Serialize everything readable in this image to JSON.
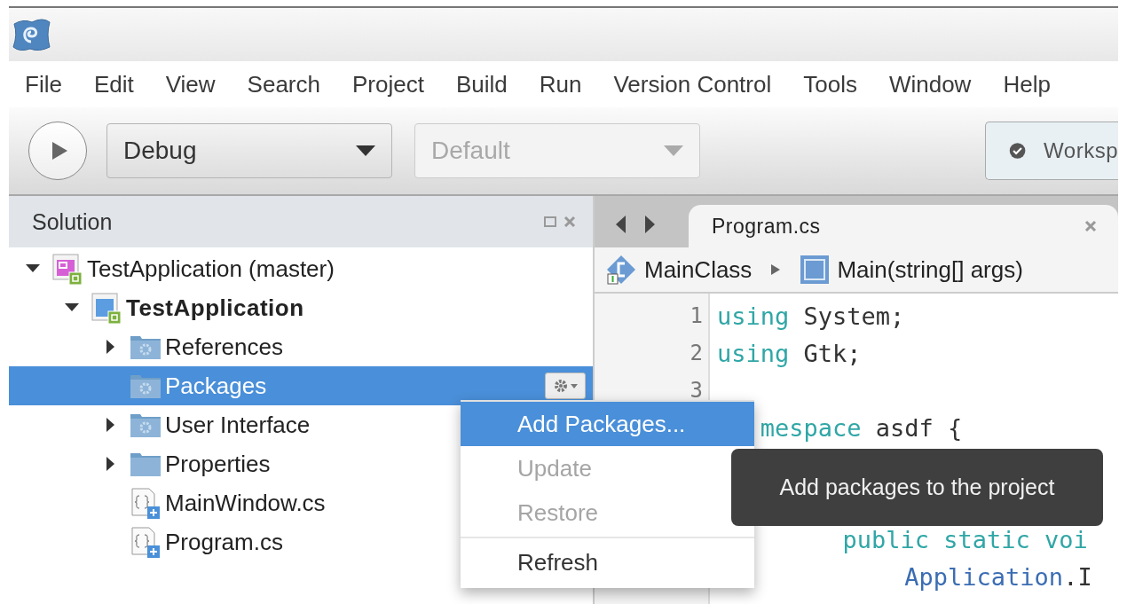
{
  "menu": [
    {
      "label": "File"
    },
    {
      "label": "Edit"
    },
    {
      "label": "View"
    },
    {
      "label": "Search"
    },
    {
      "label": "Project"
    },
    {
      "label": "Build"
    },
    {
      "label": "Run"
    },
    {
      "label": "Version Control"
    },
    {
      "label": "Tools"
    },
    {
      "label": "Window"
    },
    {
      "label": "Help"
    }
  ],
  "toolbar": {
    "configuration": {
      "value": "Debug",
      "disabled": false
    },
    "platform": {
      "value": "Default",
      "disabled": true
    },
    "status": {
      "text": "Worksp"
    }
  },
  "solution_panel": {
    "title": "Solution",
    "tree": [
      {
        "label": "TestApplication (master)",
        "kind": "solution",
        "expanded": true,
        "selected": false,
        "bold": false,
        "children": [
          {
            "label": "TestApplication",
            "kind": "project",
            "expanded": true,
            "selected": false,
            "bold": true,
            "children": [
              {
                "label": "References",
                "kind": "special-folder",
                "expanded": false,
                "selected": false,
                "bold": false
              },
              {
                "label": "Packages",
                "kind": "special-folder",
                "selected": true,
                "bold": false
              },
              {
                "label": "User Interface",
                "kind": "special-folder",
                "expanded": false,
                "selected": false,
                "bold": false
              },
              {
                "label": "Properties",
                "kind": "folder",
                "expanded": false,
                "selected": false,
                "bold": false
              },
              {
                "label": "MainWindow.cs",
                "kind": "cs-file",
                "selected": false,
                "bold": false
              },
              {
                "label": "Program.cs",
                "kind": "cs-file",
                "selected": false,
                "bold": false
              }
            ]
          }
        ]
      }
    ]
  },
  "editor": {
    "tabs": [
      {
        "label": "Program.cs",
        "selected": true
      }
    ],
    "breadcrumb": [
      {
        "text": "MainClass",
        "kind": "class"
      },
      {
        "text": "Main(string[] args)",
        "kind": "method"
      }
    ],
    "code_lines": [
      {
        "number": "1",
        "kind": "top",
        "tokens": [
          {
            "text": "using",
            "kind": "keyword"
          },
          {
            "text": " System;",
            "kind": "plain"
          }
        ]
      },
      {
        "number": "2",
        "kind": "top",
        "tokens": [
          {
            "text": "using",
            "kind": "keyword"
          },
          {
            "text": " Gtk;",
            "kind": "plain"
          }
        ]
      },
      {
        "number": "3",
        "kind": "top"
      },
      {
        "kind": "top-covered",
        "tokens": [
          {
            "text": "mespace",
            "kind": "keyword"
          },
          {
            "text": " asdf {",
            "kind": "plain"
          }
        ]
      },
      {
        "kind": "covered"
      },
      {
        "kind": "covered"
      },
      {
        "kind": "method",
        "tokens": [
          {
            "text": "public static voi",
            "kind": "keyword"
          }
        ]
      },
      {
        "kind": "statement",
        "tokens": [
          {
            "text": "Application",
            "kind": "type"
          },
          {
            "text": ".I",
            "kind": "plain"
          }
        ]
      }
    ]
  },
  "context_menu": {
    "items": [
      {
        "kind": "item",
        "label": "Add Packages...",
        "selected": true,
        "disabled": false
      },
      {
        "kind": "item",
        "label": "Update",
        "selected": false,
        "disabled": true
      },
      {
        "kind": "item",
        "label": "Restore",
        "selected": false,
        "disabled": true
      },
      {
        "kind": "separator"
      },
      {
        "kind": "item",
        "label": "Refresh",
        "selected": false,
        "disabled": false
      }
    ]
  },
  "tooltip": {
    "text": "Add packages to the project"
  }
}
